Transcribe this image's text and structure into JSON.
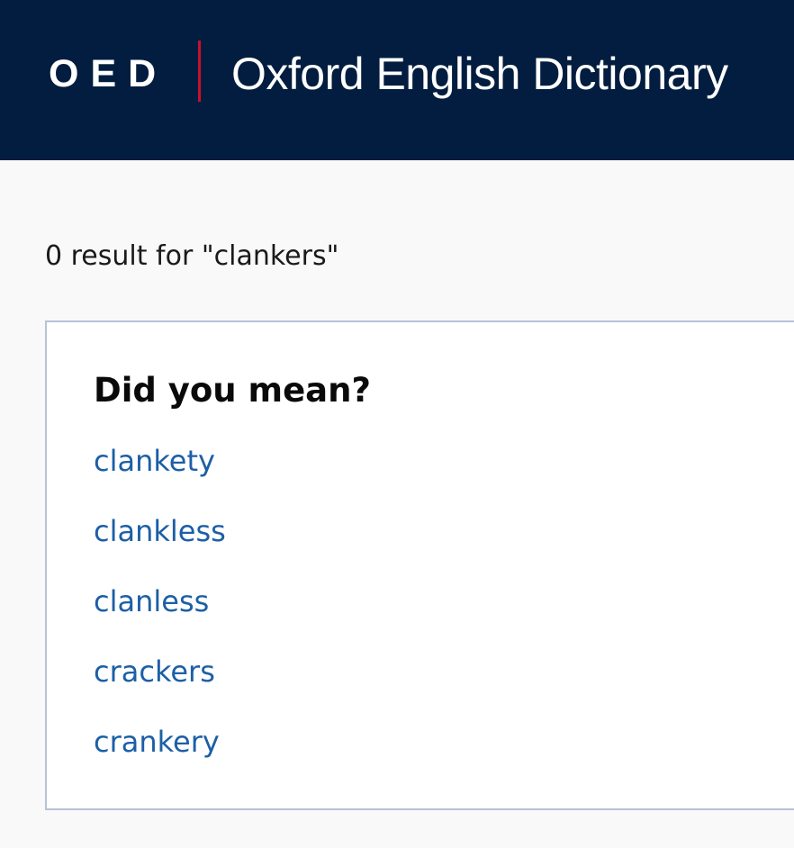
{
  "header": {
    "logo_abbr": "OED",
    "logo_full": "Oxford English Dictionary",
    "background_color": "#021d3f",
    "divider_color": "#c8102e"
  },
  "results": {
    "count_text": "0 result for \"clankers\""
  },
  "suggestions": {
    "heading": "Did you mean?",
    "items": [
      {
        "label": "clankety"
      },
      {
        "label": "clankless"
      },
      {
        "label": "clanless"
      },
      {
        "label": "crackers"
      },
      {
        "label": "crankery"
      }
    ],
    "link_color": "#1c5fa6"
  }
}
